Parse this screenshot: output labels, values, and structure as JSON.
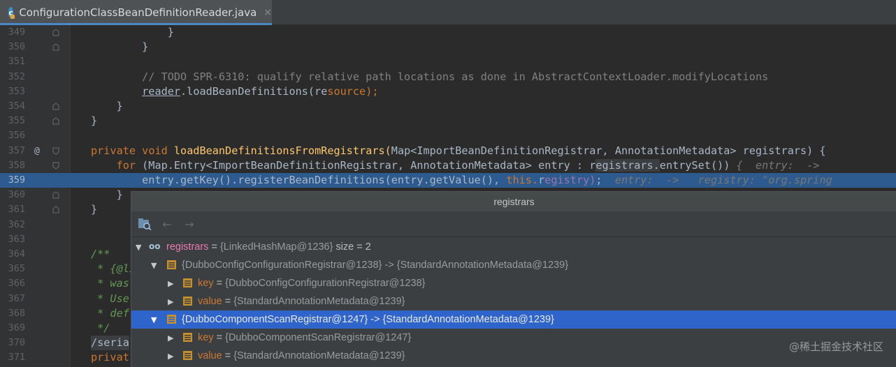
{
  "tab": {
    "file_name": "ConfigurationClassBeanDefinitionReader.java",
    "icon_letter": "c",
    "close_glyph": "×"
  },
  "editor": {
    "lines": [
      {
        "n": "349",
        "t": "            }"
      },
      {
        "n": "350",
        "t": "        }"
      },
      {
        "n": "351",
        "t": ""
      },
      {
        "n": "352",
        "t": "        // TODO SPR-6310: qualify relative path locations as done in AbstractContextLoader.modifyLocations"
      },
      {
        "n": "353",
        "t": "        reader.loadBeanDefinitions(resource);"
      },
      {
        "n": "354",
        "t": "    }"
      },
      {
        "n": "355",
        "t": "}"
      },
      {
        "n": "356",
        "t": ""
      },
      {
        "n": "357",
        "t": "private void loadBeanDefinitionsFromRegistrars(Map<ImportBeanDefinitionRegistrar, AnnotationMetadata> registrars) {"
      },
      {
        "n": "358",
        "t": "    for (Map.Entry<ImportBeanDefinitionRegistrar, AnnotationMetadata> entry : registrars.entrySet()) {  entry:  ->"
      },
      {
        "n": "359",
        "t": "        entry.getKey().registerBeanDefinitions(entry.getValue(), this.registry);  entry:  ->   registry: \"org.spring"
      },
      {
        "n": "360",
        "t": "    }"
      },
      {
        "n": "361",
        "t": "}"
      },
      {
        "n": "362",
        "t": ""
      },
      {
        "n": "363",
        "t": ""
      },
      {
        "n": "364",
        "t": "/**"
      },
      {
        "n": "365",
        "t": " * {@li"
      },
      {
        "n": "366",
        "t": " * was"
      },
      {
        "n": "367",
        "t": " * Use"
      },
      {
        "n": "368",
        "t": " * def"
      },
      {
        "n": "369",
        "t": " */"
      },
      {
        "n": "370",
        "t": "/seria"
      },
      {
        "n": "371",
        "t": "privat"
      }
    ],
    "override_marker": "@"
  },
  "popup": {
    "title": "registrars",
    "rows": [
      {
        "name": "registrars",
        "eq": " = ",
        "value": "{LinkedHashMap@1236}",
        "extra": "  size = 2"
      },
      {
        "value": "{DubboConfigConfigurationRegistrar@1238} -> {StandardAnnotationMetadata@1239}"
      },
      {
        "name": "key",
        "eq": " = ",
        "value": "{DubboConfigConfigurationRegistrar@1238}"
      },
      {
        "name": "value",
        "eq": " = ",
        "value": "{StandardAnnotationMetadata@1239}"
      },
      {
        "value": "{DubboComponentScanRegistrar@1247} -> {StandardAnnotationMetadata@1239}"
      },
      {
        "name": "key",
        "eq": " = ",
        "value": "{DubboComponentScanRegistrar@1247}"
      },
      {
        "name": "value",
        "eq": " = ",
        "value": "{StandardAnnotationMetadata@1239}"
      }
    ]
  },
  "watermark": "@稀土掘金技术社区",
  "colors": {
    "selection": "#2f65ca",
    "current_line": "#2d5a8f",
    "background": "#2b2b2b",
    "keyword": "#cc7832",
    "method": "#ffc66d"
  }
}
